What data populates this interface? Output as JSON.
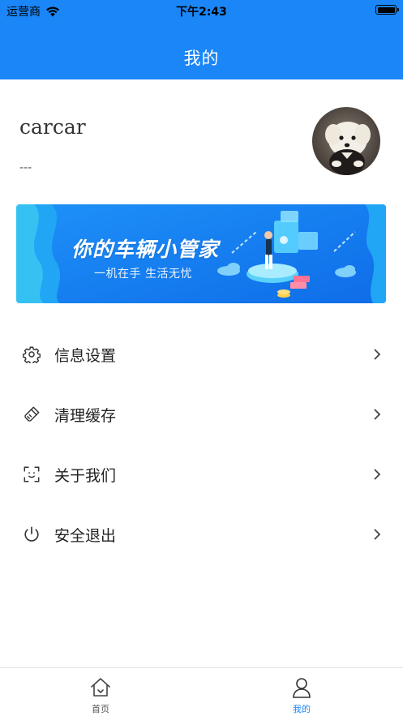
{
  "status_bar": {
    "carrier": "运营商",
    "time": "下午2:43"
  },
  "header": {
    "title": "我的"
  },
  "profile": {
    "username": "carcar",
    "signature": "---"
  },
  "banner": {
    "title": "你的车辆小管家",
    "subtitle": "一机在手 生活无忧"
  },
  "menu": {
    "items": [
      {
        "label": "信息设置",
        "icon": "gear-icon"
      },
      {
        "label": "清理缓存",
        "icon": "broom-icon"
      },
      {
        "label": "关于我们",
        "icon": "face-scan-icon"
      },
      {
        "label": "安全退出",
        "icon": "power-icon"
      }
    ]
  },
  "tabbar": {
    "tabs": [
      {
        "label": "首页",
        "icon": "home-icon",
        "active": false
      },
      {
        "label": "我的",
        "icon": "user-icon",
        "active": true
      }
    ]
  },
  "colors": {
    "primary": "#1a86f8",
    "tab_inactive": "#555555"
  }
}
